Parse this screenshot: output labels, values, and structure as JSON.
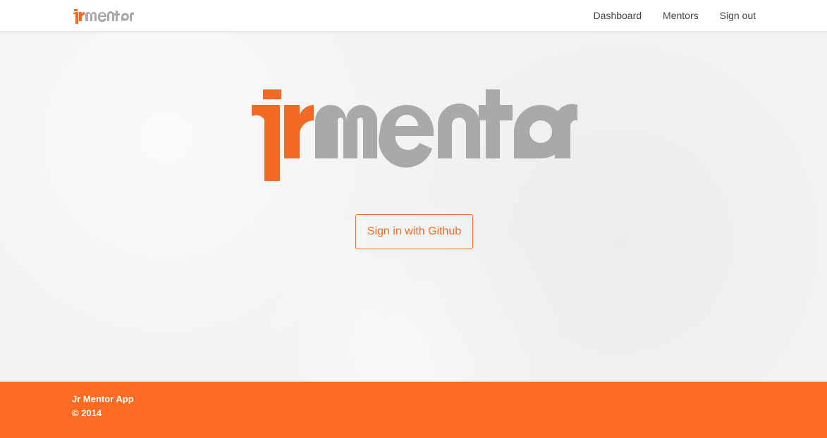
{
  "brand": {
    "logo_text": "jrmentor",
    "accent_color": "#f26a26",
    "logo_gray": "#a9a9a9"
  },
  "nav": {
    "items": [
      {
        "label": "Dashboard"
      },
      {
        "label": "Mentors"
      },
      {
        "label": "Sign out"
      }
    ]
  },
  "hero": {
    "logo_text": "jrmentor",
    "signin_label": "Sign in with Github"
  },
  "footer": {
    "title": "Jr Mentor App",
    "copyright": "© 2014",
    "background_color": "#fb6c22"
  }
}
